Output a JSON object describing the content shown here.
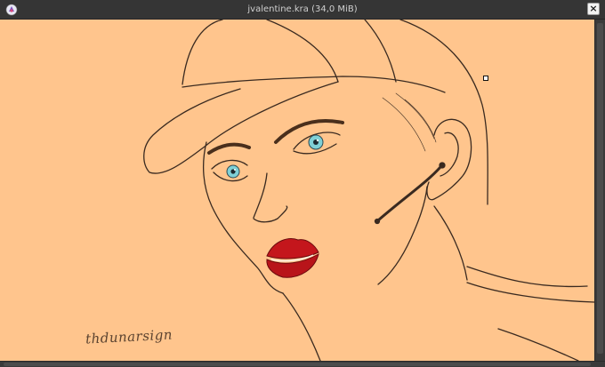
{
  "window": {
    "title": "jvalentine.kra (34,0 MiB)",
    "close_label": "×"
  },
  "canvas": {
    "background_color": "#FFC58D",
    "signature": "thdunarsign"
  },
  "colors": {
    "line": "#3a2a20",
    "lips": "#c4161c",
    "iris": "#7fd0d6",
    "brow": "#4a2f1c"
  }
}
